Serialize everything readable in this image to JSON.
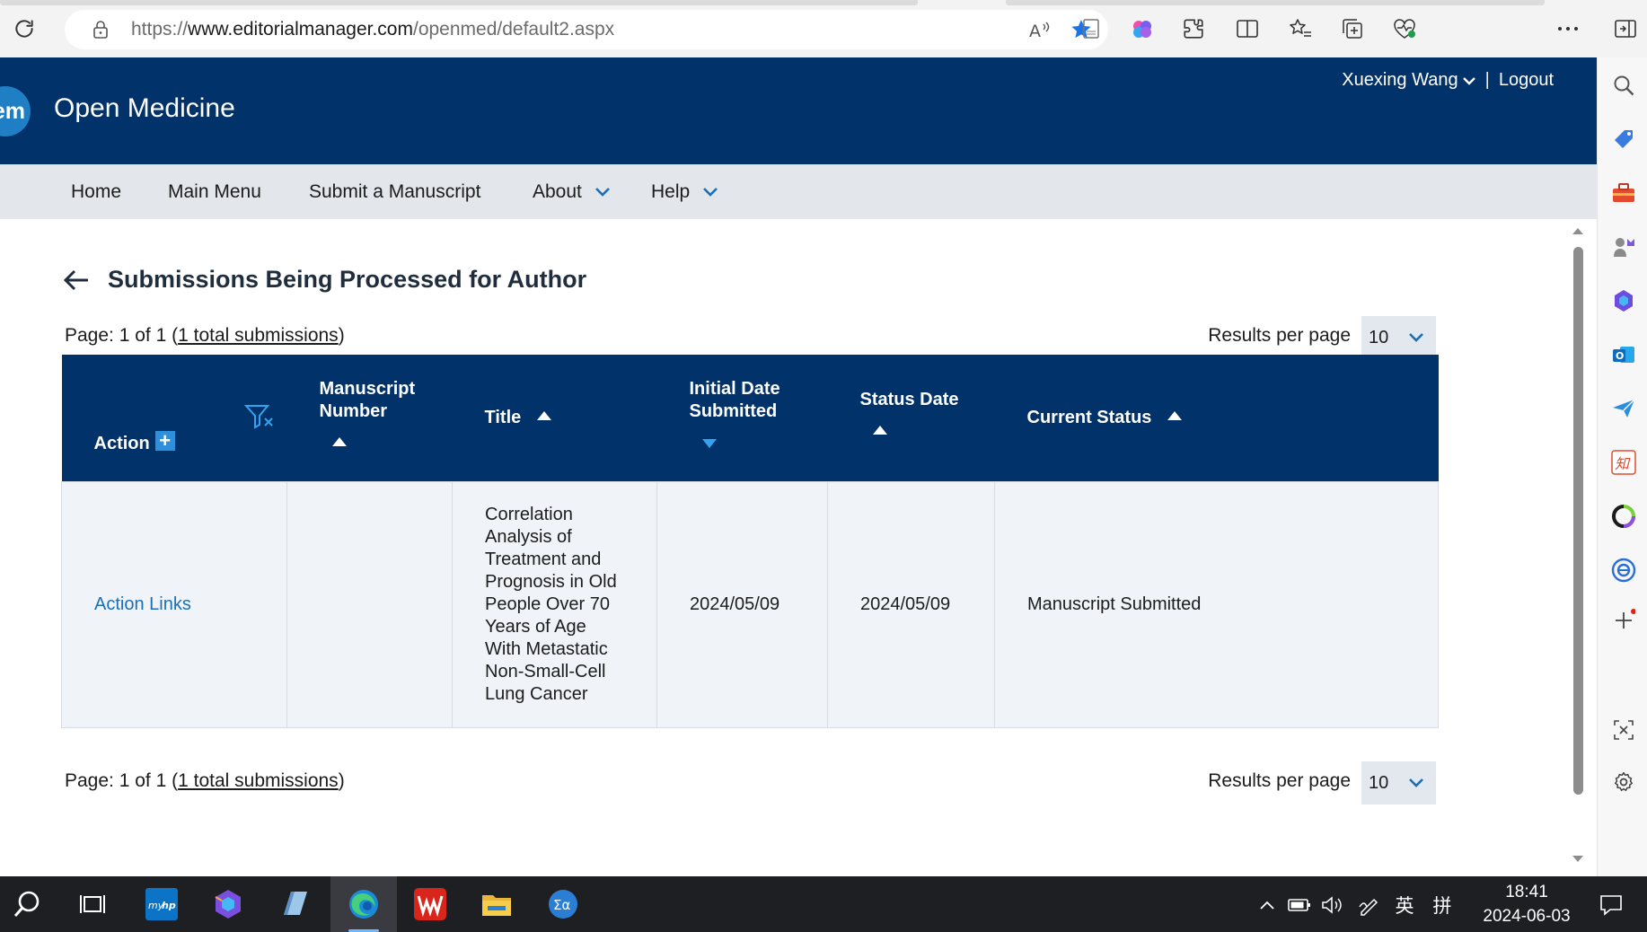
{
  "browser": {
    "url_scheme": "https://",
    "url_host": "www.editorialmanager.com",
    "url_path": "/openmed/default2.aspx"
  },
  "site": {
    "logo_text": "em",
    "title": "Open Medicine",
    "user_name": "Xuexing Wang",
    "separator": "|",
    "logout": "Logout"
  },
  "nav": {
    "home": "Home",
    "main_menu": "Main Menu",
    "submit": "Submit a Manuscript",
    "about": "About",
    "help": "Help"
  },
  "page": {
    "heading": "Submissions Being Processed for Author"
  },
  "pager_top": {
    "prefix": "Page: 1 of 1 (",
    "link": "1 total submissions",
    "suffix": ")",
    "rpp_label": "Results per page",
    "rpp_value": "10"
  },
  "pager_bottom": {
    "prefix": "Page: 1 of 1 (",
    "link": "1 total submissions",
    "suffix": ")",
    "rpp_label": "Results per page",
    "rpp_value": "10"
  },
  "table": {
    "headers": {
      "action": "Action",
      "manuscript_line1": "Manuscript",
      "manuscript_line2": "Number",
      "title": "Title",
      "initial_line1": "Initial Date",
      "initial_line2": "Submitted",
      "status_date": "Status Date",
      "current_status": "Current Status"
    },
    "rows": [
      {
        "action": "Action Links",
        "manuscript_number": "",
        "title_lines": [
          "Correlation",
          "Analysis of",
          "Treatment and",
          "Prognosis in Old",
          "People Over 70",
          "Years of Age",
          "With Metastatic",
          "Non-Small-Cell",
          "Lung Cancer"
        ],
        "initial_date": "2024/05/09",
        "status_date": "2024/05/09",
        "current_status": "Manuscript Submitted"
      }
    ]
  },
  "taskbar": {
    "ime_lang": "英",
    "ime_mode": "拼",
    "time": "18:41",
    "date": "2024-06-03"
  },
  "colors": {
    "header_bg": "#01326a",
    "nav_bg": "#e3e6ea",
    "link": "#1b6fb5",
    "accent": "#2f8fdb"
  }
}
